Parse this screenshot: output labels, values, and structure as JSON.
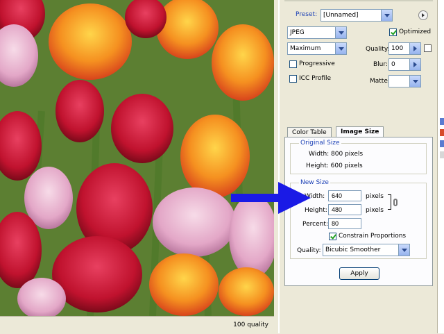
{
  "status_bar": {
    "text": "100 quality"
  },
  "settings": {
    "preset_label": "Preset:",
    "preset_value": "[Unnamed]",
    "format_value": "JPEG",
    "optimized_label": "Optimized",
    "optimized_checked": true,
    "compression_value": "Maximum",
    "quality_label": "Quality:",
    "quality_value": "100",
    "progressive_label": "Progressive",
    "blur_label": "Blur:",
    "blur_value": "0",
    "icc_label": "ICC Profile",
    "matte_label": "Matte:"
  },
  "tabs": [
    {
      "label": "Color Table",
      "active": false
    },
    {
      "label": "Image Size",
      "active": true
    }
  ],
  "image_size": {
    "original_title": "Original Size",
    "original_width": "Width: 800 pixels",
    "original_height": "Height: 600 pixels",
    "new_title": "New Size",
    "width_label": "Width:",
    "width_value": "640",
    "width_unit": "pixels",
    "height_label": "Height:",
    "height_value": "480",
    "height_unit": "pixels",
    "percent_label": "Percent:",
    "percent_value": "80",
    "constrain_label": "Constrain Proportions",
    "constrain_checked": true,
    "quality_label": "Quality:",
    "quality_value": "Bicubic Smoother",
    "apply_label": "Apply"
  },
  "colors": {
    "arrow": "#1a1ae6",
    "group_title": "#1a3fb5"
  }
}
